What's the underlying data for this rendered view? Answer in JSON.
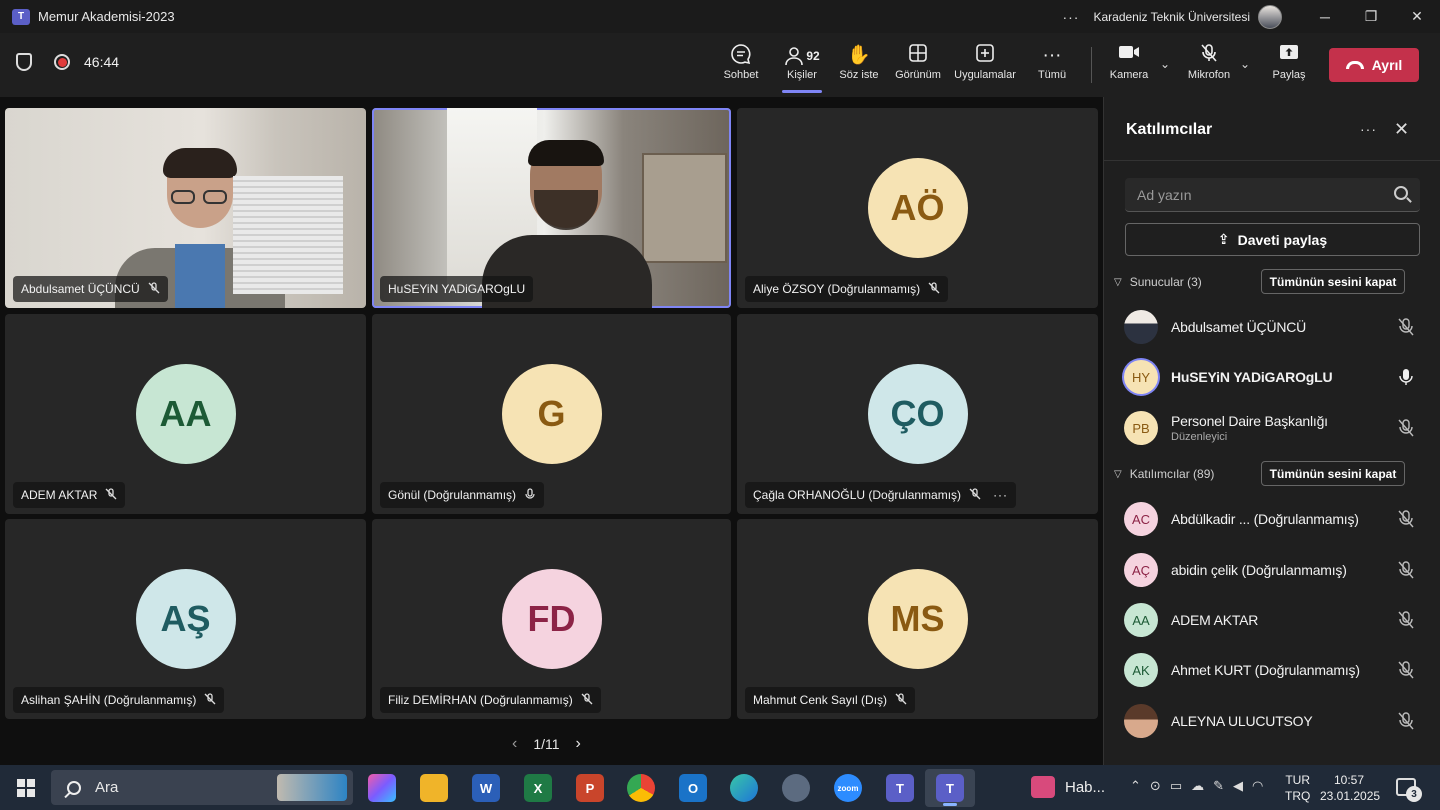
{
  "window": {
    "title": "Memur Akademisi-2023",
    "organization": "Karadeniz Teknik Üniversitesi",
    "controls": {
      "minimize": "─",
      "restore": "❐",
      "close": "✕"
    }
  },
  "meeting": {
    "timer": "46:44",
    "toolbar": {
      "chat": "Sohbet",
      "people": "Kişiler",
      "people_count": "92",
      "raise_hand": "Söz iste",
      "view": "Görünüm",
      "apps": "Uygulamalar",
      "more": "Tümü",
      "camera": "Kamera",
      "mic": "Mikrofon",
      "share": "Paylaş",
      "leave": "Ayrıl"
    }
  },
  "grid": {
    "tiles": [
      {
        "name": "Abdulsamet ÜÇÜNCÜ",
        "type": "video"
      },
      {
        "name": "HuSEYiN YADiGAROgLU",
        "type": "video"
      },
      {
        "name": "Aliye ÖZSOY (Doğrulanmamış)",
        "initials": "AÖ",
        "color": "#f6e3b4",
        "text_color": "#8a5a12"
      },
      {
        "name": "ADEM AKTAR",
        "initials": "AA",
        "color": "#c7e6d3",
        "text_color": "#1c5a35"
      },
      {
        "name": "Gönül (Doğrulanmamış)",
        "initials": "G",
        "color": "#f6e3b4",
        "text_color": "#8a5a12"
      },
      {
        "name": "Çağla ORHANOĞLU (Doğrulanmamış)",
        "initials": "ÇO",
        "color": "#cfe7e9",
        "text_color": "#1f5c61"
      },
      {
        "name": "Aslihan ŞAHİN (Doğrulanmamış)",
        "initials": "AŞ",
        "color": "#cfe7e9",
        "text_color": "#1f5c61"
      },
      {
        "name": "Filiz DEMİRHAN (Doğrulanmamış)",
        "initials": "FD",
        "color": "#f5d3df",
        "text_color": "#8c2346"
      },
      {
        "name": "Mahmut Cenk Sayıl (Dış)",
        "initials": "MS",
        "color": "#f6e3b4",
        "text_color": "#8a5a12"
      }
    ],
    "page": "1/11"
  },
  "panel": {
    "title": "Katılımcılar",
    "search_placeholder": "Ad yazın",
    "invite": "Daveti paylaş",
    "presenters_header": "Sunucular (3)",
    "attendees_header": "Katılımcılar (89)",
    "mute_all": "Tümünün sesini kapat",
    "presenters": [
      {
        "name": "Abdulsamet ÜÇÜNCÜ",
        "initials": "",
        "role": ""
      },
      {
        "name": "HuSEYiN YADiGAROgLU",
        "initials": "HY",
        "role": ""
      },
      {
        "name": "Personel Daire Başkanlığı",
        "initials": "PB",
        "role": "Düzenleyici"
      }
    ],
    "attendees": [
      {
        "name": "Abdülkadir ... (Doğrulanmamış)",
        "initials": "AC"
      },
      {
        "name": "abidin çelik (Doğrulanmamış)",
        "initials": "AÇ"
      },
      {
        "name": "ADEM AKTAR",
        "initials": "AA"
      },
      {
        "name": "Ahmet KURT (Doğrulanmamış)",
        "initials": "AK"
      },
      {
        "name": "ALEYNA ULUCUTSOY",
        "initials": ""
      }
    ]
  },
  "taskbar": {
    "search": "Ara",
    "news": "Hab...",
    "lang_top": "TUR",
    "lang_bottom": "TRQ",
    "time": "10:57",
    "date": "23.01.2025",
    "notifications": "3"
  }
}
